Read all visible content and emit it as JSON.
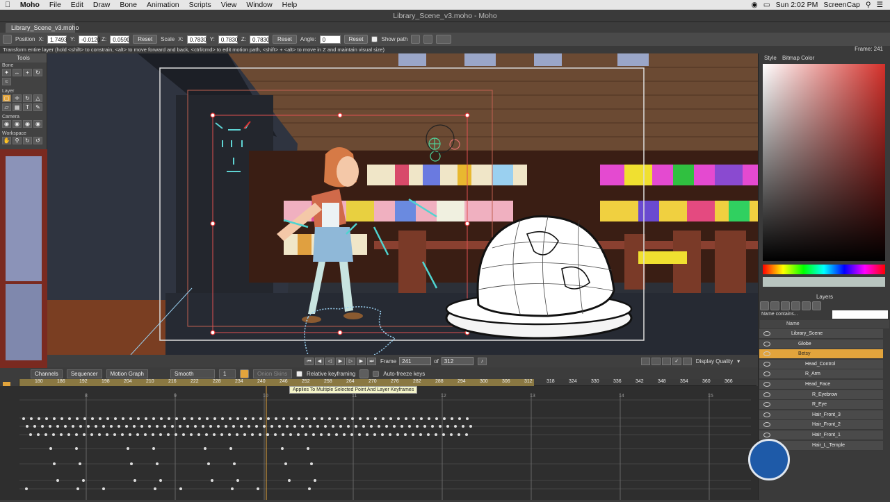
{
  "menubar": {
    "apple": "",
    "items": [
      "Moho",
      "File",
      "Edit",
      "Draw",
      "Bone",
      "Animation",
      "Scripts",
      "View",
      "Window",
      "Help"
    ],
    "clock": "Sun 2:02 PM",
    "user": "ScreenCap"
  },
  "window": {
    "title": "Library_Scene_v3.moho - Moho",
    "doc_tab": "Library_Scene_v3.moho"
  },
  "tool_options": {
    "position_label": "Position",
    "x_label": "X:",
    "x_value": "1.7493",
    "y_label": "Y:",
    "y_value": "-0.0120",
    "z_label": "Z:",
    "z_value": "0.0590",
    "reset1": "Reset",
    "scale_label": "Scale",
    "sx_label": "X:",
    "sx_value": "0.7830",
    "sy_label": "Y:",
    "sy_value": "0.7830",
    "sz_label": "Z:",
    "sz_value": "0.7830",
    "reset2": "Reset",
    "angle_label": "Angle:",
    "angle_value": "0",
    "reset3": "Reset",
    "show_path": "Show path"
  },
  "hint": "Transform entire layer (hold <shift> to constrain, <alt> to move forward and back, <ctrl/cmd> to edit motion path, <shift> + <alt> to move in Z and maintain visual size)",
  "frame_label": "Frame: 241",
  "tools": {
    "title": "Tools",
    "sections": [
      "Bone",
      "Layer",
      "Camera",
      "Workspace"
    ]
  },
  "playback": {
    "frame_label": "Frame",
    "frame_value": "241",
    "of_label": "of",
    "total": "312",
    "display_quality": "Display Quality"
  },
  "timeline": {
    "tabs": [
      "Channels",
      "Sequencer",
      "Motion Graph"
    ],
    "interp": "Smooth",
    "interp_num": "1",
    "onion": "Onion Skins",
    "relative": "Relative keyframing",
    "autofreeze": "Auto-freeze keys",
    "ticks": [
      "180",
      "186",
      "192",
      "198",
      "204",
      "210",
      "216",
      "222",
      "228",
      "234",
      "240",
      "246",
      "252",
      "258",
      "264",
      "270",
      "276",
      "282",
      "288",
      "294",
      "300",
      "306",
      "312",
      "318",
      "324",
      "330",
      "336",
      "342",
      "348",
      "354",
      "360",
      "366"
    ],
    "tooltip": "Applies To Multiple Selected Point And Layer Keyframes",
    "markers": [
      "8",
      "9",
      "10",
      "11",
      "12",
      "13",
      "14",
      "15"
    ]
  },
  "right": {
    "style_tab": "Style",
    "bitmap_tab": "Bitmap Color",
    "layers_title": "Layers",
    "search_placeholder": "Name contains...",
    "name_col": "Name",
    "layers": [
      {
        "name": "Library_Scene",
        "indent": 0,
        "selected": false
      },
      {
        "name": "Globe",
        "indent": 1,
        "selected": false
      },
      {
        "name": "Betsy",
        "indent": 1,
        "selected": true
      },
      {
        "name": "Head_Control",
        "indent": 2,
        "selected": false
      },
      {
        "name": "R_Arm",
        "indent": 2,
        "selected": false
      },
      {
        "name": "Head_Face",
        "indent": 2,
        "selected": false
      },
      {
        "name": "R_Eyebrow",
        "indent": 3,
        "selected": false
      },
      {
        "name": "R_Eye",
        "indent": 3,
        "selected": false
      },
      {
        "name": "Hair_Front_3",
        "indent": 3,
        "selected": false
      },
      {
        "name": "Hair_Front_2",
        "indent": 3,
        "selected": false
      },
      {
        "name": "Hair_Front_1",
        "indent": 3,
        "selected": false
      },
      {
        "name": "Hair_L_Temple",
        "indent": 3,
        "selected": false
      }
    ]
  },
  "colors": {
    "accent": "#e2a43c",
    "timeline_ruler": "#9a8548"
  }
}
